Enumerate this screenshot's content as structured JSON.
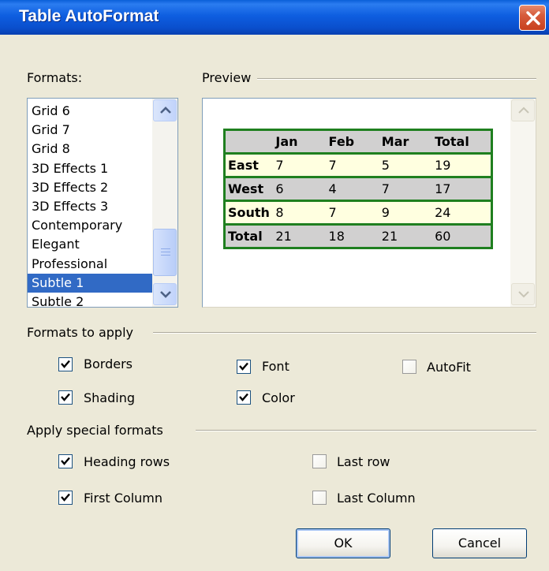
{
  "window": {
    "title": "Table AutoFormat"
  },
  "formats": {
    "label": "Formats:",
    "items": [
      "Grid 6",
      "Grid 7",
      "Grid 8",
      "3D Effects 1",
      "3D Effects 2",
      "3D Effects 3",
      "Contemporary",
      "Elegant",
      "Professional",
      "Subtle 1",
      "Subtle 2"
    ],
    "selected": "Subtle 1"
  },
  "preview": {
    "label": "Preview",
    "table": {
      "header": [
        "",
        "Jan",
        "Feb",
        "Mar",
        "Total"
      ],
      "rows": [
        [
          "East",
          "7",
          "7",
          "5",
          "19"
        ],
        [
          "West",
          "6",
          "4",
          "7",
          "17"
        ],
        [
          "South",
          "8",
          "7",
          "9",
          "24"
        ],
        [
          "Total",
          "21",
          "18",
          "21",
          "60"
        ]
      ]
    },
    "colors": {
      "border": "#1f7f1f",
      "gray_row": "#d1d0d0",
      "light_row": "#ffffe0"
    }
  },
  "formats_to_apply": {
    "label": "Formats to apply",
    "borders": {
      "label": "Borders",
      "checked": true
    },
    "font": {
      "label": "Font",
      "checked": true
    },
    "autofit": {
      "label": "AutoFit",
      "checked": false
    },
    "shading": {
      "label": "Shading",
      "checked": true
    },
    "color": {
      "label": "Color",
      "checked": true
    }
  },
  "special_formats": {
    "label": "Apply special formats",
    "heading_rows": {
      "label": "Heading rows",
      "checked": true
    },
    "last_row": {
      "label": "Last row",
      "checked": false
    },
    "first_column": {
      "label": "First Column",
      "checked": true
    },
    "last_column": {
      "label": "Last Column",
      "checked": false
    }
  },
  "buttons": {
    "ok": "OK",
    "cancel": "Cancel"
  },
  "icons": {
    "close": "close-icon",
    "scroll_up": "scroll-up-arrow-icon",
    "scroll_down": "scroll-down-arrow-icon",
    "check": "checkmark-icon"
  }
}
